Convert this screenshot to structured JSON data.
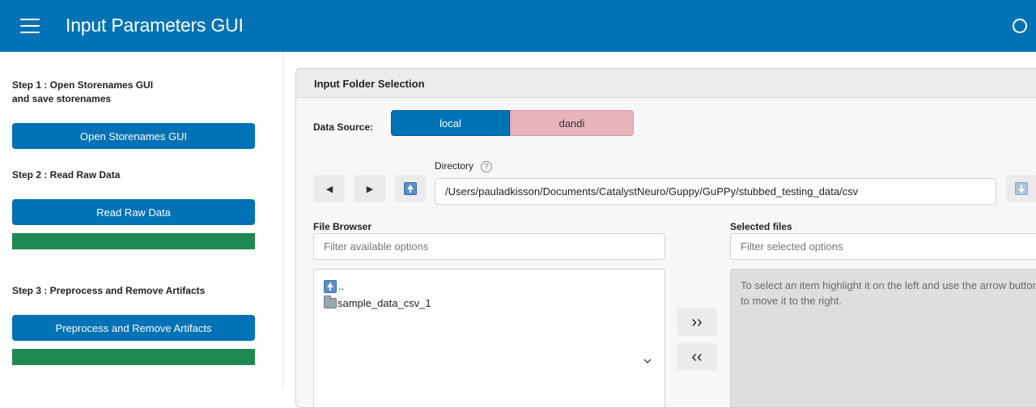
{
  "header": {
    "title": "Input Parameters GUI"
  },
  "sidebar": {
    "step1": {
      "label_line1": "Step 1 : Open Storenames GUI",
      "label_line2": "and save storenames",
      "button": "Open Storenames GUI"
    },
    "step2": {
      "label": "Step 2 : Read Raw Data",
      "button": "Read Raw Data",
      "progress": 1.0
    },
    "step3": {
      "label": "Step 3 : Preprocess and Remove Artifacts",
      "button": "Preprocess and Remove Artifacts",
      "progress": 1.0
    }
  },
  "card": {
    "title": "Input Folder Selection",
    "data_source": {
      "label": "Data Source:",
      "options": [
        "local",
        "dandi"
      ],
      "selected": "local"
    },
    "nav": {
      "back": "◀",
      "forward": "▶",
      "up_icon": "up-arrow-icon",
      "go_icon": "down-arrow-icon"
    },
    "directory": {
      "label": "Directory",
      "help": "?",
      "value": "/Users/pauladkisson/Documents/CatalystNeuro/Guppy/GuPPy/stubbed_testing_data/csv"
    },
    "file_browser": {
      "label": "File Browser",
      "filter_placeholder": "Filter available options",
      "items": [
        {
          "name": "..",
          "icon": "up-arrow-icon"
        },
        {
          "name": "sample_data_csv_1",
          "icon": "folder-icon"
        }
      ]
    },
    "transfer": {
      "add": "››",
      "remove": "‹‹"
    },
    "selected_files": {
      "label": "Selected files",
      "filter_placeholder": "Filter selected options",
      "hint": "To select an item highlight it on the left and use the arrow button to move it to the right."
    }
  },
  "colors": {
    "primary": "#0072b5",
    "success": "#1e8a4f",
    "inactive_toggle": "#e8b4bc"
  }
}
